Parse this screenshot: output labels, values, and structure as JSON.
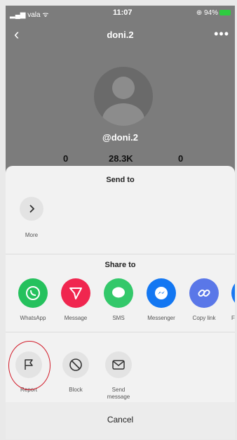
{
  "status_bar": {
    "carrier": "vala",
    "time": "11:07",
    "battery": "94%"
  },
  "header": {
    "title": "doni.2",
    "more": "•••"
  },
  "profile": {
    "handle": "@doni.2",
    "following": "0",
    "followers": "28.3K",
    "likes": "0"
  },
  "send_to": {
    "title": "Send to",
    "items": [
      {
        "label": "More",
        "icon": "chevron-right-icon"
      }
    ]
  },
  "share_to": {
    "title": "Share to",
    "items": [
      {
        "label": "WhatsApp",
        "icon": "whatsapp-icon",
        "color": "#25c15d"
      },
      {
        "label": "Message",
        "icon": "send-icon",
        "color": "#f0264f"
      },
      {
        "label": "SMS",
        "icon": "sms-bubble-icon",
        "color": "#33c86a"
      },
      {
        "label": "Messenger",
        "icon": "messenger-icon",
        "color": "#1377f2"
      },
      {
        "label": "Copy link",
        "icon": "link-icon",
        "color": "#5a77e8"
      },
      {
        "label": "Fa",
        "icon": "facebook-icon",
        "color": "#1877f2"
      }
    ]
  },
  "actions": {
    "items": [
      {
        "label": "Report",
        "icon": "flag-icon"
      },
      {
        "label": "Block",
        "icon": "block-icon"
      },
      {
        "label": "Send",
        "label2": "message",
        "icon": "envelope-icon"
      }
    ]
  },
  "cancel": {
    "label": "Cancel"
  }
}
